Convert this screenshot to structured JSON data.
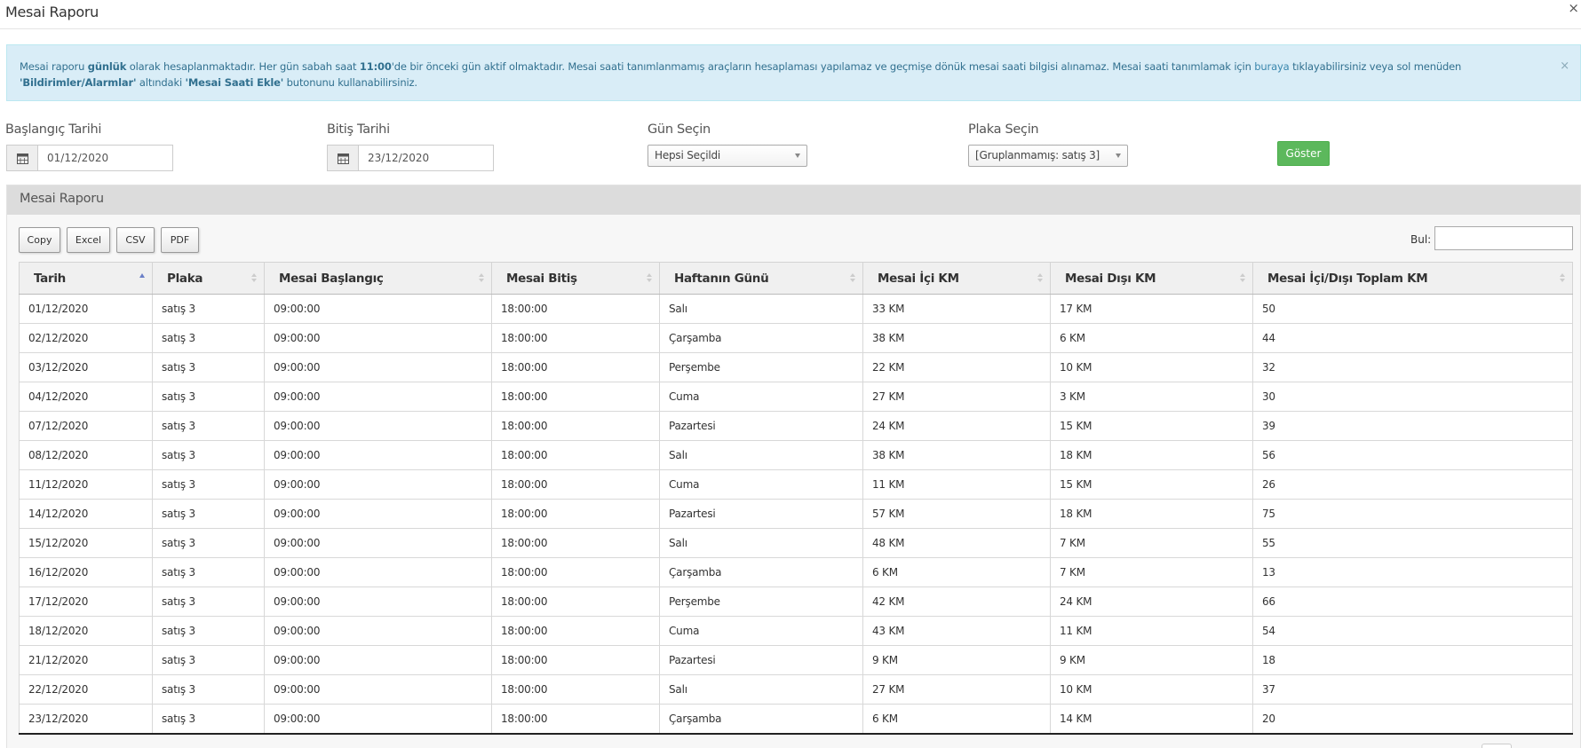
{
  "modal": {
    "title": "Mesai Raporu",
    "close": "×"
  },
  "alert": {
    "s1": "Mesai raporu ",
    "b1": "günlük",
    "s2": " olarak hesaplanmaktadır. Her gün sabah saat ",
    "b2": "11:00",
    "s3": "'de bir önceki gün aktif olmaktadır. Mesai saati tanımlanmamış araçların hesaplaması yapılamaz ve geçmişe dönük mesai saati bilgisi alınamaz. Mesai saati tanımlamak için ",
    "link": "buraya",
    "s4": " tıklayabilirsiniz veya sol menüden ",
    "b3": "'Bildirimler/Alarmlar'",
    "s5": " altındaki ",
    "b4": "'Mesai Saati Ekle'",
    "s6": " butonunu kullanabilirsiniz.",
    "close": "×"
  },
  "filters": {
    "start_label": "Başlangıç Tarihi",
    "start_value": "01/12/2020",
    "end_label": "Bitiş Tarihi",
    "end_value": "23/12/2020",
    "day_label": "Gün Seçin",
    "day_value": "Hepsi Seçildi",
    "plate_label": "Plaka Seçin",
    "plate_value": "[Gruplanmamış: satış 3]",
    "show_button": "Göster"
  },
  "panel": {
    "title": "Mesai Raporu"
  },
  "toolbar": {
    "copy": "Copy",
    "excel": "Excel",
    "csv": "CSV",
    "pdf": "PDF",
    "search_label": "Bul:"
  },
  "table": {
    "headers": [
      "Tarih",
      "Plaka",
      "Mesai Başlangıç",
      "Mesai Bitiş",
      "Haftanın Günü",
      "Mesai İçi KM",
      "Mesai Dışı KM",
      "Mesai İçi/Dışı Toplam KM"
    ],
    "sorted_column": 0,
    "rows": [
      [
        "01/12/2020",
        "satış 3",
        "09:00:00",
        "18:00:00",
        "Salı",
        "33 KM",
        "17 KM",
        "50"
      ],
      [
        "02/12/2020",
        "satış 3",
        "09:00:00",
        "18:00:00",
        "Çarşamba",
        "38 KM",
        "6 KM",
        "44"
      ],
      [
        "03/12/2020",
        "satış 3",
        "09:00:00",
        "18:00:00",
        "Perşembe",
        "22 KM",
        "10 KM",
        "32"
      ],
      [
        "04/12/2020",
        "satış 3",
        "09:00:00",
        "18:00:00",
        "Cuma",
        "27 KM",
        "3 KM",
        "30"
      ],
      [
        "07/12/2020",
        "satış 3",
        "09:00:00",
        "18:00:00",
        "Pazartesi",
        "24 KM",
        "15 KM",
        "39"
      ],
      [
        "08/12/2020",
        "satış 3",
        "09:00:00",
        "18:00:00",
        "Salı",
        "38 KM",
        "18 KM",
        "56"
      ],
      [
        "11/12/2020",
        "satış 3",
        "09:00:00",
        "18:00:00",
        "Cuma",
        "11 KM",
        "15 KM",
        "26"
      ],
      [
        "14/12/2020",
        "satış 3",
        "09:00:00",
        "18:00:00",
        "Pazartesi",
        "57 KM",
        "18 KM",
        "75"
      ],
      [
        "15/12/2020",
        "satış 3",
        "09:00:00",
        "18:00:00",
        "Salı",
        "48 KM",
        "7 KM",
        "55"
      ],
      [
        "16/12/2020",
        "satış 3",
        "09:00:00",
        "18:00:00",
        "Çarşamba",
        "6 KM",
        "7 KM",
        "13"
      ],
      [
        "17/12/2020",
        "satış 3",
        "09:00:00",
        "18:00:00",
        "Perşembe",
        "42 KM",
        "24 KM",
        "66"
      ],
      [
        "18/12/2020",
        "satış 3",
        "09:00:00",
        "18:00:00",
        "Cuma",
        "43 KM",
        "11 KM",
        "54"
      ],
      [
        "21/12/2020",
        "satış 3",
        "09:00:00",
        "18:00:00",
        "Pazartesi",
        "9 KM",
        "9 KM",
        "18"
      ],
      [
        "22/12/2020",
        "satış 3",
        "09:00:00",
        "18:00:00",
        "Salı",
        "27 KM",
        "10 KM",
        "37"
      ],
      [
        "23/12/2020",
        "satış 3",
        "09:00:00",
        "18:00:00",
        "Çarşamba",
        "6 KM",
        "14 KM",
        "20"
      ]
    ]
  },
  "colors": {
    "alert_bg": "#d9edf7",
    "alert_text": "#31708f",
    "show_button": "#5cb85c",
    "panel_header": "#dcdcdc"
  },
  "icons": {
    "date_addon": "calendar-icon",
    "select_arrow": "caret-down-icon",
    "sort": "sort-arrows-icon"
  }
}
